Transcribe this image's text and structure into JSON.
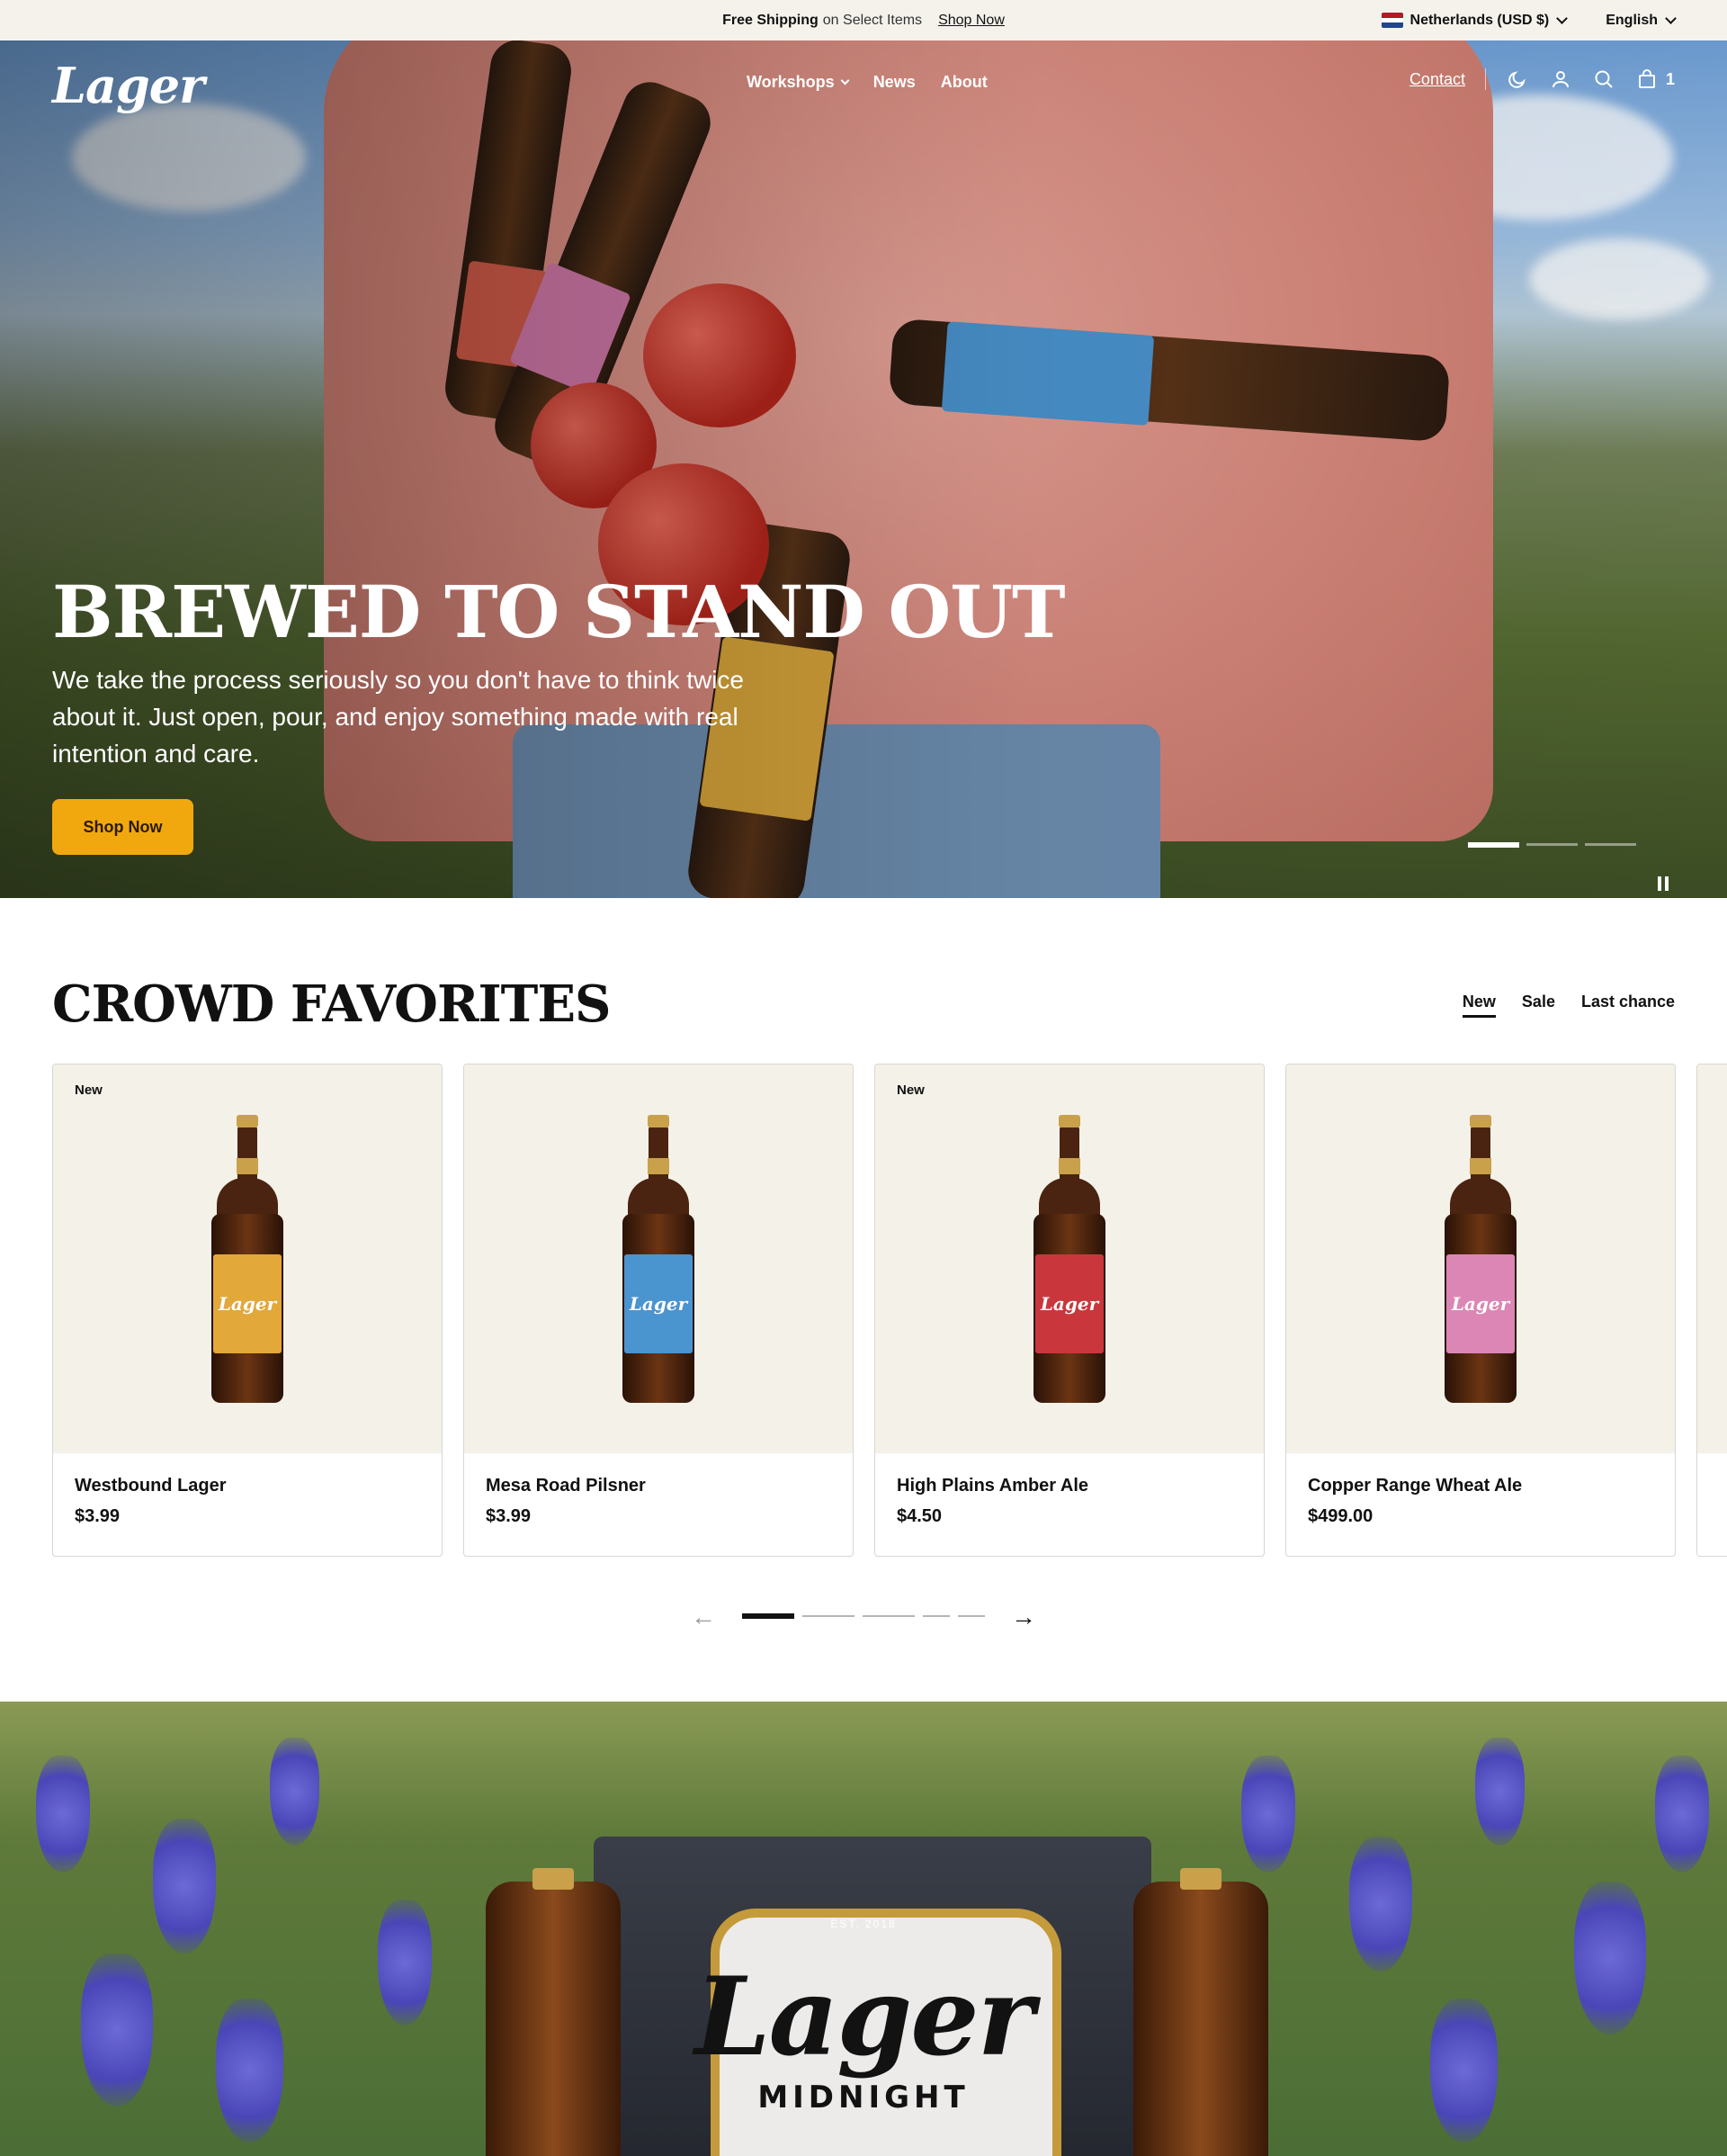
{
  "announcement": {
    "bold": "Free Shipping",
    "rest": "on Select Items",
    "link": "Shop Now",
    "country": "Netherlands (USD $)",
    "language": "English"
  },
  "header": {
    "logo": "Lager",
    "menu": [
      "Workshops",
      "News",
      "About"
    ],
    "contact": "Contact",
    "cart_count": "1",
    "icons": [
      "moon-icon",
      "user-icon",
      "search-icon",
      "bag-icon"
    ]
  },
  "hero": {
    "title": "BREWED TO STAND OUT",
    "subtitle": "We take the process seriously so you don't have to think twice about it. Just open, pour, and enjoy something made with real intention and care.",
    "button": "Shop Now",
    "slide_count": 3,
    "active_slide": 1
  },
  "favorites": {
    "title": "CROWD FAVORITES",
    "tabs": [
      "New",
      "Sale",
      "Last chance"
    ],
    "active_tab": "New",
    "products": [
      {
        "badge": "New",
        "name": "Westbound Lager",
        "price": "$3.99",
        "label_color": "#e2a83a"
      },
      {
        "badge": "",
        "name": "Mesa Road Pilsner",
        "price": "$3.99",
        "label_color": "#4a94cf"
      },
      {
        "badge": "New",
        "name": "High Plains Amber Ale",
        "price": "$4.50",
        "label_color": "#c9373d"
      },
      {
        "badge": "",
        "name": "Copper Range Wheat Ale",
        "price": "$499.00",
        "label_color": "#dc86b6"
      }
    ],
    "pager_pages": 5,
    "pager_active": 1
  },
  "banner": {
    "logo": "Lager",
    "sub": "MIDNIGHT",
    "est": "EST. 2018"
  },
  "colors": {
    "accent": "#f1a80f",
    "cream": "#f4f1e8",
    "announcement_bg": "#f5f2ec",
    "flag": [
      "#ae1c28",
      "#ffffff",
      "#21468b"
    ]
  }
}
